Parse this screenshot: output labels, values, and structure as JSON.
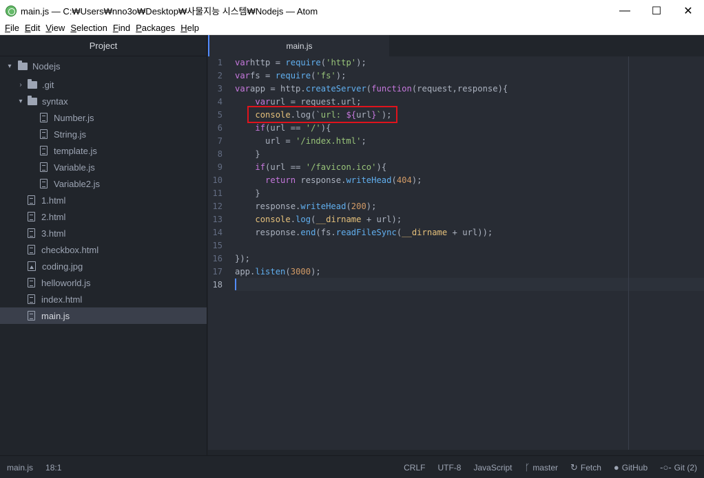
{
  "window": {
    "title": "main.js — C:₩Users₩nno3o₩Desktop₩사물지능 시스템₩Nodejs — Atom",
    "minimize": "—",
    "maximize": "☐",
    "close": "✕"
  },
  "menu": [
    {
      "u": "F",
      "rest": "ile"
    },
    {
      "u": "E",
      "rest": "dit"
    },
    {
      "u": "V",
      "rest": "iew"
    },
    {
      "u": "S",
      "rest": "election"
    },
    {
      "u": "F",
      "rest": "ind"
    },
    {
      "u": "P",
      "rest": "ackages"
    },
    {
      "u": "H",
      "rest": "elp"
    }
  ],
  "sidebar": {
    "header": "Project",
    "tree": [
      {
        "label": "Nodejs",
        "kind": "folder",
        "expanded": true
      },
      {
        "label": ".git",
        "kind": "folder",
        "expanded": false
      },
      {
        "label": "syntax",
        "kind": "folder",
        "expanded": true
      },
      {
        "label": "Number.js",
        "kind": "file"
      },
      {
        "label": "String.js",
        "kind": "file"
      },
      {
        "label": "template.js",
        "kind": "file"
      },
      {
        "label": "Variable.js",
        "kind": "file"
      },
      {
        "label": "Variable2.js",
        "kind": "file"
      },
      {
        "label": "1.html",
        "kind": "file"
      },
      {
        "label": "2.html",
        "kind": "file"
      },
      {
        "label": "3.html",
        "kind": "file"
      },
      {
        "label": "checkbox.html",
        "kind": "file"
      },
      {
        "label": "coding.jpg",
        "kind": "image"
      },
      {
        "label": "helloworld.js",
        "kind": "file"
      },
      {
        "label": "index.html",
        "kind": "file"
      },
      {
        "label": "main.js",
        "kind": "file",
        "selected": true
      }
    ]
  },
  "editor": {
    "active_tab": "main.js",
    "current_line": 18,
    "line_numbers": [
      "1",
      "2",
      "3",
      "4",
      "5",
      "6",
      "7",
      "8",
      "9",
      "10",
      "11",
      "12",
      "13",
      "14",
      "15",
      "16",
      "17",
      "18"
    ]
  },
  "status": {
    "file": "main.js",
    "cursor": "18:1",
    "line_ending": "CRLF",
    "encoding": "UTF-8",
    "grammar": "JavaScript",
    "branch": "master",
    "fetch": "Fetch",
    "github": "GitHub",
    "git": "Git (2)"
  },
  "colors": {
    "accent": "#528bff",
    "highlight_box": "#e0131c"
  }
}
